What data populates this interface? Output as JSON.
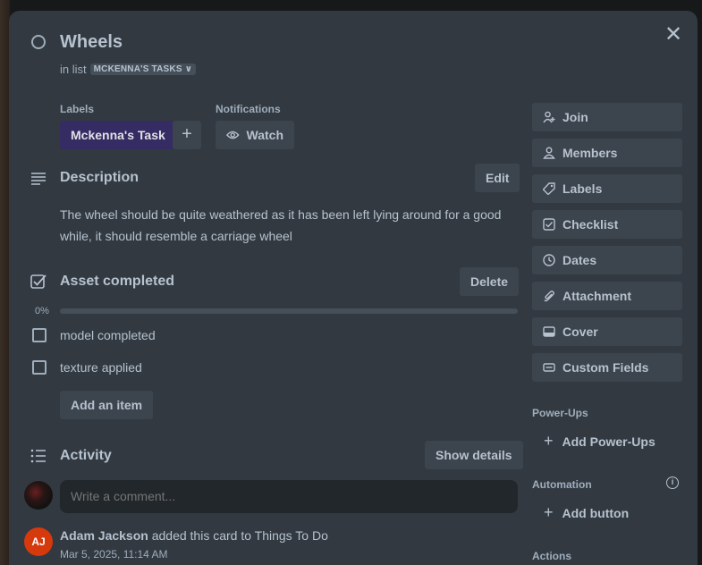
{
  "card": {
    "title": "Wheels",
    "in_list_prefix": "in list",
    "list_name": "MCKENNA'S TASKS"
  },
  "labels": {
    "heading": "Labels",
    "items": [
      "Mckenna's Task"
    ],
    "add_symbol": "+"
  },
  "notifications": {
    "heading": "Notifications",
    "watch_label": "Watch"
  },
  "description": {
    "heading": "Description",
    "edit_label": "Edit",
    "text": "The wheel should be quite weathered as it has been left lying around for a good while, it should resemble a carriage wheel"
  },
  "checklist": {
    "heading": "Asset completed",
    "delete_label": "Delete",
    "progress_text": "0%",
    "progress_fraction": 0,
    "items": [
      {
        "text": "model completed",
        "checked": false
      },
      {
        "text": "texture applied",
        "checked": false
      }
    ],
    "add_item_label": "Add an item"
  },
  "activity": {
    "heading": "Activity",
    "show_details_label": "Show details",
    "comment_placeholder": "Write a comment...",
    "entries": [
      {
        "initials": "AJ",
        "user": "Adam Jackson",
        "action": "added this card to Things To Do",
        "time": "Mar 5, 2025, 11:14 AM"
      }
    ]
  },
  "sidebar": {
    "buttons": [
      "Join",
      "Members",
      "Labels",
      "Checklist",
      "Dates",
      "Attachment",
      "Cover",
      "Custom Fields"
    ],
    "powerups_heading": "Power-Ups",
    "add_powerups_label": "Add Power-Ups",
    "automation_heading": "Automation",
    "add_button_label": "Add button",
    "actions_heading": "Actions"
  },
  "colors": {
    "modal_bg": "#323940",
    "label_purple": "#352c63",
    "avatar_orange": "#d6390c",
    "button_bg": "#3c444d"
  }
}
